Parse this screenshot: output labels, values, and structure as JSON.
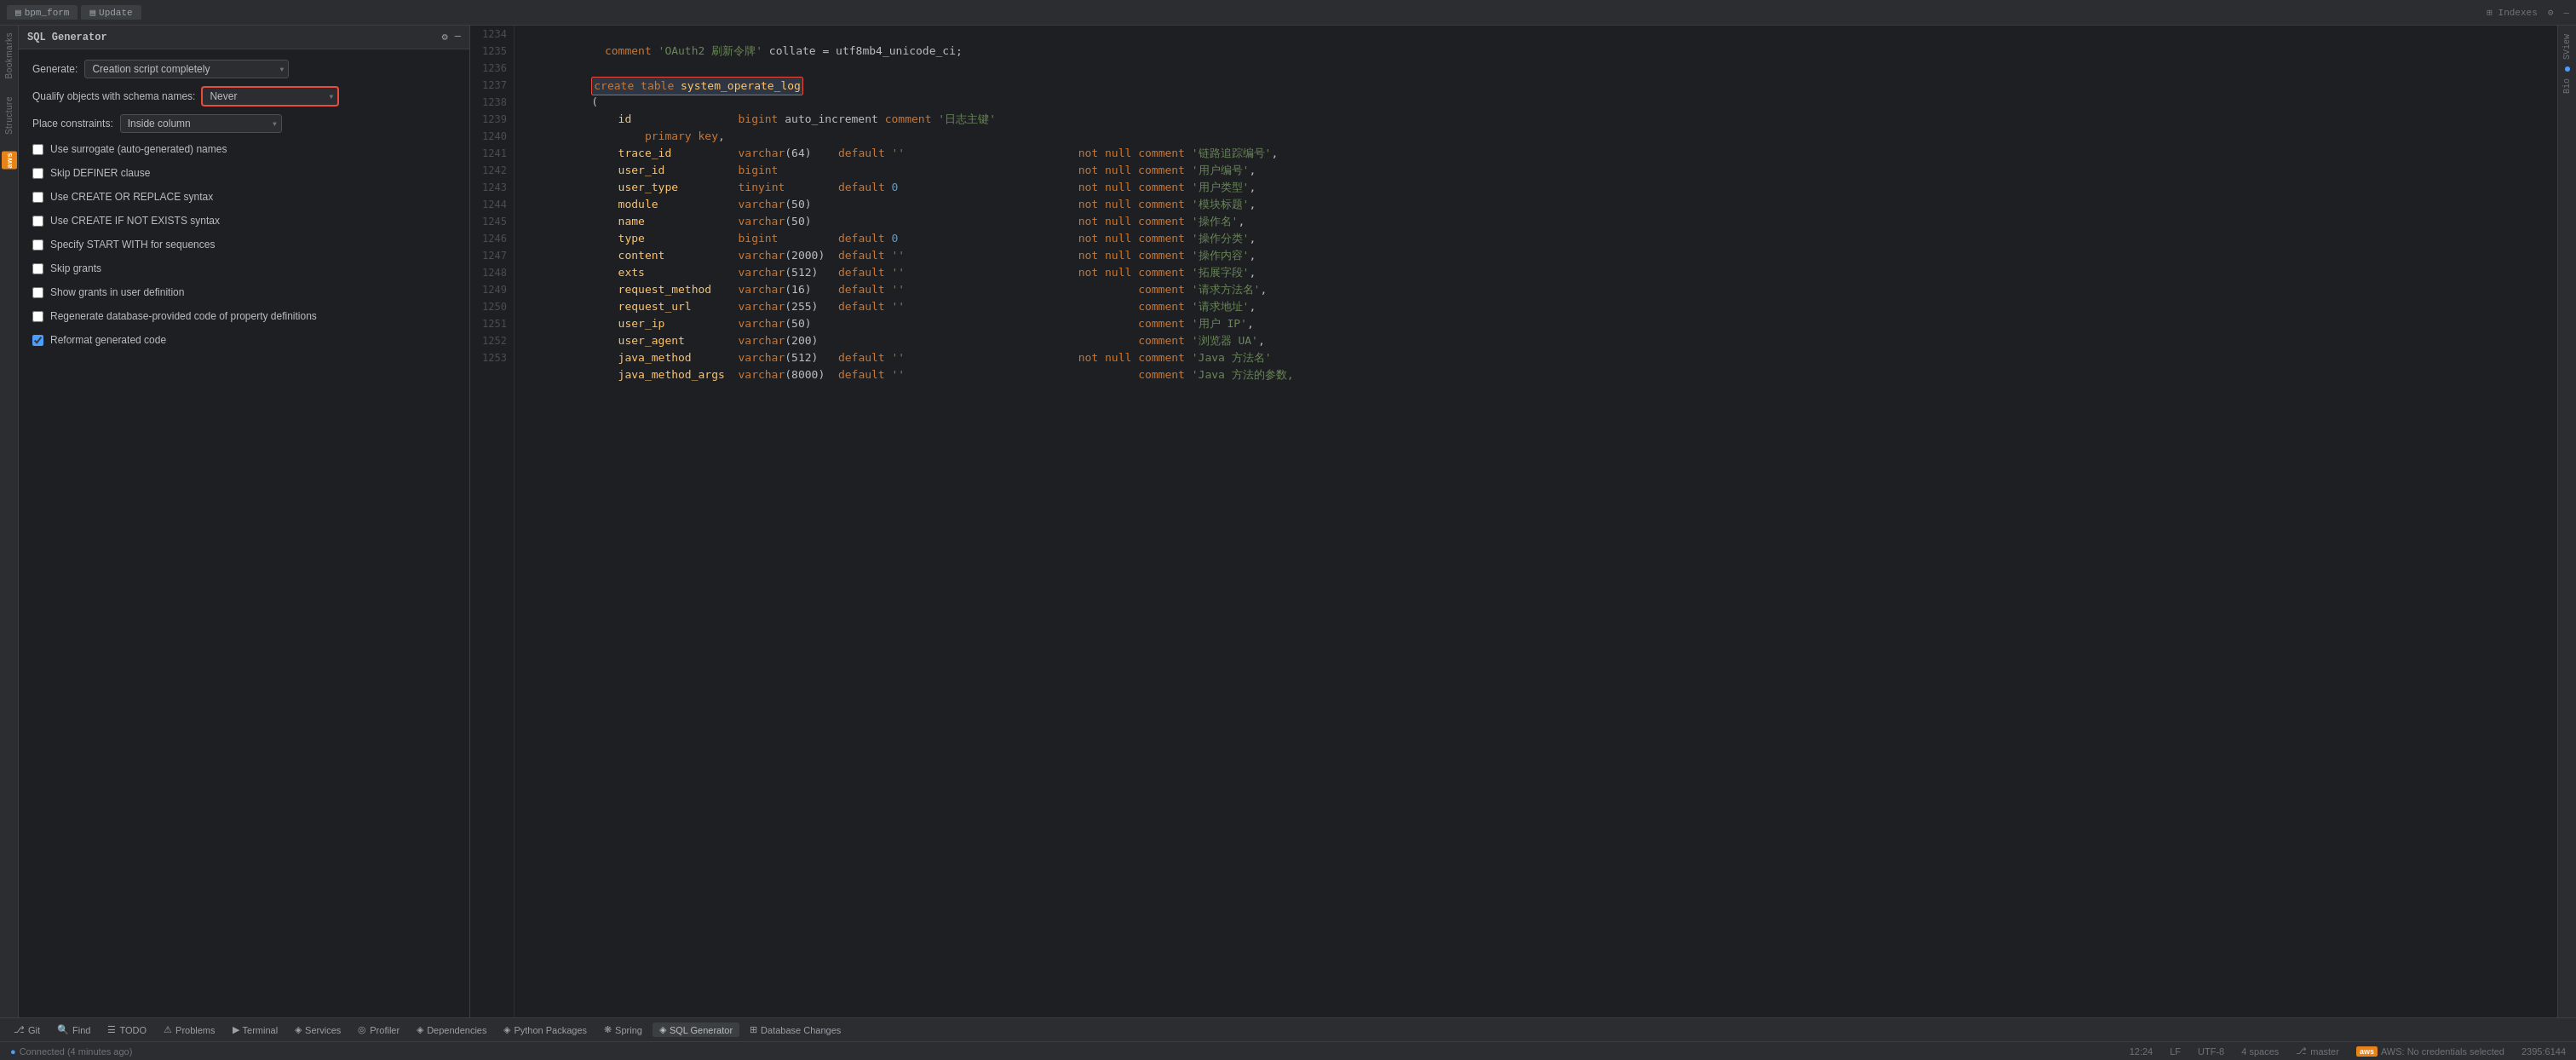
{
  "header": {
    "tabs": [
      {
        "label": "bpm_form",
        "icon": "📋"
      },
      {
        "label": "Update",
        "icon": "📋"
      }
    ],
    "right_tabs": [
      "Indexes"
    ],
    "icons": [
      "gear",
      "minus"
    ]
  },
  "left_panel": {
    "title": "SQL Generator",
    "generate_label": "Generate:",
    "generate_value": "Creation script completely",
    "qualify_label": "Qualify objects with schema names:",
    "qualify_value": "Never",
    "constraints_label": "Place constraints:",
    "constraints_value": "Inside column",
    "checkboxes": [
      {
        "id": "cb1",
        "label": "Use surrogate (auto-generated) names",
        "checked": false
      },
      {
        "id": "cb2",
        "label": "Skip DEFINER clause",
        "checked": false
      },
      {
        "id": "cb3",
        "label": "Use CREATE OR REPLACE syntax",
        "checked": false
      },
      {
        "id": "cb4",
        "label": "Use CREATE IF NOT EXISTS syntax",
        "checked": false
      },
      {
        "id": "cb5",
        "label": "Specify START WITH for sequences",
        "checked": false
      },
      {
        "id": "cb6",
        "label": "Skip grants",
        "checked": false
      },
      {
        "id": "cb7",
        "label": "Show grants in user definition",
        "checked": false
      },
      {
        "id": "cb8",
        "label": "Regenerate database-provided code of property definitions",
        "checked": false
      },
      {
        "id": "cb9",
        "label": "Reformat generated code",
        "checked": true
      }
    ]
  },
  "code_editor": {
    "lines": [
      {
        "num": 1234,
        "content": "  comment 'OAuth2 刷新令牌' collate = utf8mb4_unicode_ci;"
      },
      {
        "num": 1235,
        "content": ""
      },
      {
        "num": 1236,
        "content": "create table system_operate_log",
        "highlight": true
      },
      {
        "num": 1237,
        "content": "("
      },
      {
        "num": 1238,
        "content": "    id                bigint auto_increment comment '日志主键'"
      },
      {
        "num": 1239,
        "content": "        primary key,"
      },
      {
        "num": 1240,
        "content": "    trace_id          varchar(64)    default ''                          not null comment '链路追踪编号',"
      },
      {
        "num": 1241,
        "content": "    user_id           bigint                                             not null comment '用户编号',"
      },
      {
        "num": 1242,
        "content": "    user_type         tinyint        default 0                           not null comment '用户类型',"
      },
      {
        "num": 1243,
        "content": "    module            varchar(50)                                        not null comment '模块标题',"
      },
      {
        "num": 1244,
        "content": "    name              varchar(50)                                        not null comment '操作名',"
      },
      {
        "num": 1245,
        "content": "    type              bigint         default 0                           not null comment '操作分类',"
      },
      {
        "num": 1246,
        "content": "    content           varchar(2000)  default ''                          not null comment '操作内容',"
      },
      {
        "num": 1247,
        "content": "    exts              varchar(512)   default ''                          not null comment '拓展字段',"
      },
      {
        "num": 1248,
        "content": "    request_method    varchar(16)    default ''                                   comment '请求方法名',"
      },
      {
        "num": 1249,
        "content": "    request_url       varchar(255)   default ''                                   comment '请求地址',"
      },
      {
        "num": 1250,
        "content": "    user_ip           varchar(50)                                                 comment '用户 IP',"
      },
      {
        "num": 1251,
        "content": "    user_agent        varchar(200)                                                comment '浏览器 UA',"
      },
      {
        "num": 1252,
        "content": "    java_method       varchar(512)   default ''                          not null comment 'Java 方法名'"
      },
      {
        "num": 1253,
        "content": "    java_method_args  varchar(8000)  default ''                                   comment 'Java 方法的参数,"
      }
    ]
  },
  "right_sidebar": {
    "items": [
      "SView",
      "Bio"
    ]
  },
  "bottom_toolbar": {
    "items": [
      {
        "icon": "git",
        "label": "Git"
      },
      {
        "icon": "find",
        "label": "Find"
      },
      {
        "icon": "todo",
        "label": "TODO"
      },
      {
        "icon": "problems",
        "label": "Problems"
      },
      {
        "icon": "terminal",
        "label": "Terminal"
      },
      {
        "icon": "services",
        "label": "Services"
      },
      {
        "icon": "profiler",
        "label": "Profiler"
      },
      {
        "icon": "dependencies",
        "label": "Dependencies"
      },
      {
        "icon": "python",
        "label": "Python Packages"
      },
      {
        "icon": "spring",
        "label": "Spring"
      },
      {
        "icon": "sqlgen",
        "label": "SQL Generator"
      },
      {
        "icon": "dbchanges",
        "label": "Database Changes"
      }
    ]
  },
  "status_bar": {
    "left": [
      {
        "icon": "circle",
        "text": "Connected (4 minutes ago)"
      }
    ],
    "right": [
      {
        "text": "12:24"
      },
      {
        "text": "LF"
      },
      {
        "text": "UTF-8"
      },
      {
        "text": "4 spaces"
      },
      {
        "text": "master"
      },
      {
        "text": "AWS: No credentials selected"
      },
      {
        "text": "2395:6144"
      }
    ]
  },
  "v_sidebar": {
    "items": [
      "Bookmarks",
      "Structure",
      "AWS Toolkit"
    ]
  }
}
